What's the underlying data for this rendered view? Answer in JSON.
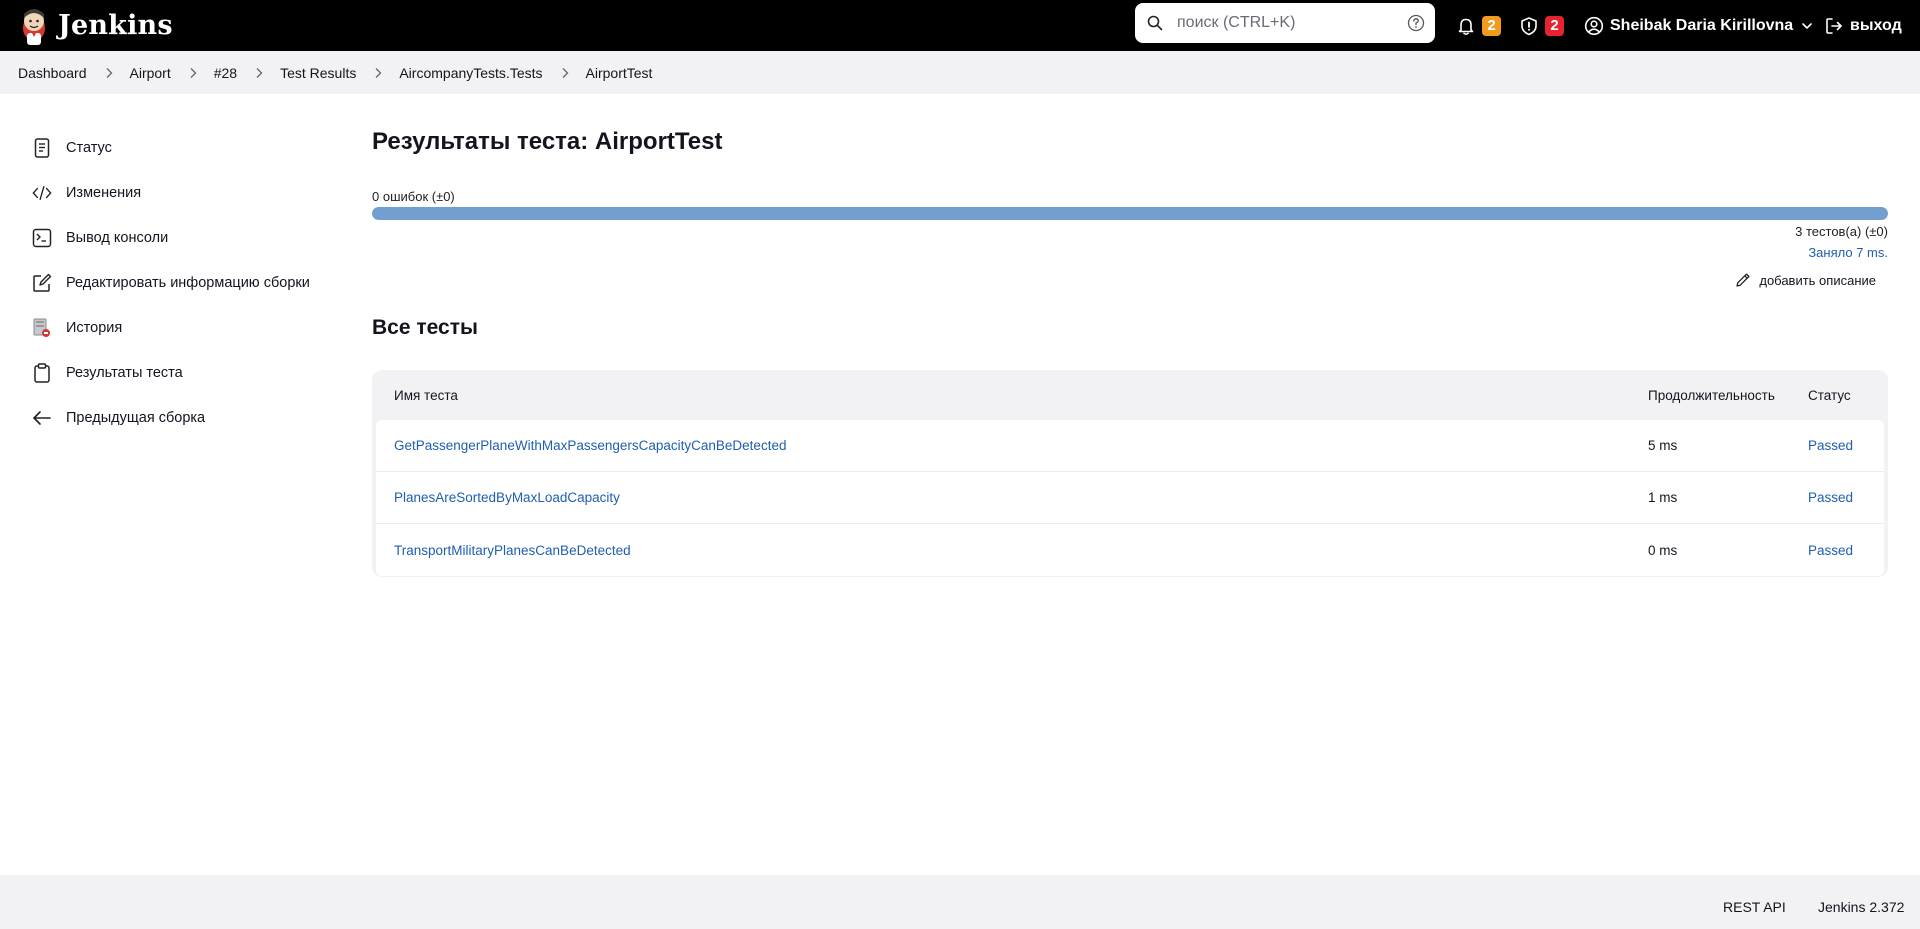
{
  "header": {
    "brand": "Jenkins",
    "search_placeholder": "поиск (CTRL+K)",
    "notifications_count": "2",
    "security_count": "2",
    "user_name": "Sheibak Daria Kirillovna",
    "logout_label": "выход",
    "colors": {
      "background": "#000000",
      "notif_badge": "#f19c1f",
      "security_badge": "#e6242f"
    }
  },
  "breadcrumb": [
    "Dashboard",
    "Airport",
    "#28",
    "Test Results",
    "AircompanyTests.Tests",
    "AirportTest"
  ],
  "sidebar": {
    "items": [
      {
        "label": "Статус",
        "icon": "document-icon"
      },
      {
        "label": "Изменения",
        "icon": "code-icon"
      },
      {
        "label": "Вывод консоли",
        "icon": "terminal-icon"
      },
      {
        "label": "Редактировать информацию сборки",
        "icon": "edit-icon"
      },
      {
        "label": "История",
        "icon": "history-icon"
      },
      {
        "label": "Результаты теста",
        "icon": "clipboard-icon"
      },
      {
        "label": "Предыдущая сборка",
        "icon": "arrow-left-icon"
      }
    ]
  },
  "main": {
    "title": "Результаты теста: AirportTest",
    "failures": "0 ошибок (±0)",
    "pass_fraction": 1.0,
    "tests_count": "3 тестов(а) (±0)",
    "took": "Заняло 7 ms.",
    "add_description": "добавить описание",
    "all_tests_heading": "Все тесты",
    "table": {
      "headers": {
        "name": "Имя теста",
        "duration": "Продолжительность",
        "status": "Статус"
      },
      "rows": [
        {
          "name": "GetPassengerPlaneWithMaxPassengersCapacityCanBeDetected",
          "duration": "5 ms",
          "status": "Passed"
        },
        {
          "name": "PlanesAreSortedByMaxLoadCapacity",
          "duration": "1 ms",
          "status": "Passed"
        },
        {
          "name": "TransportMilitaryPlanesCanBeDetected",
          "duration": "0 ms",
          "status": "Passed"
        }
      ]
    },
    "colors": {
      "bar_fill": "#729fcf",
      "link": "#1f5fb0"
    }
  },
  "footer": {
    "rest_api": "REST API",
    "version": "Jenkins 2.372"
  }
}
